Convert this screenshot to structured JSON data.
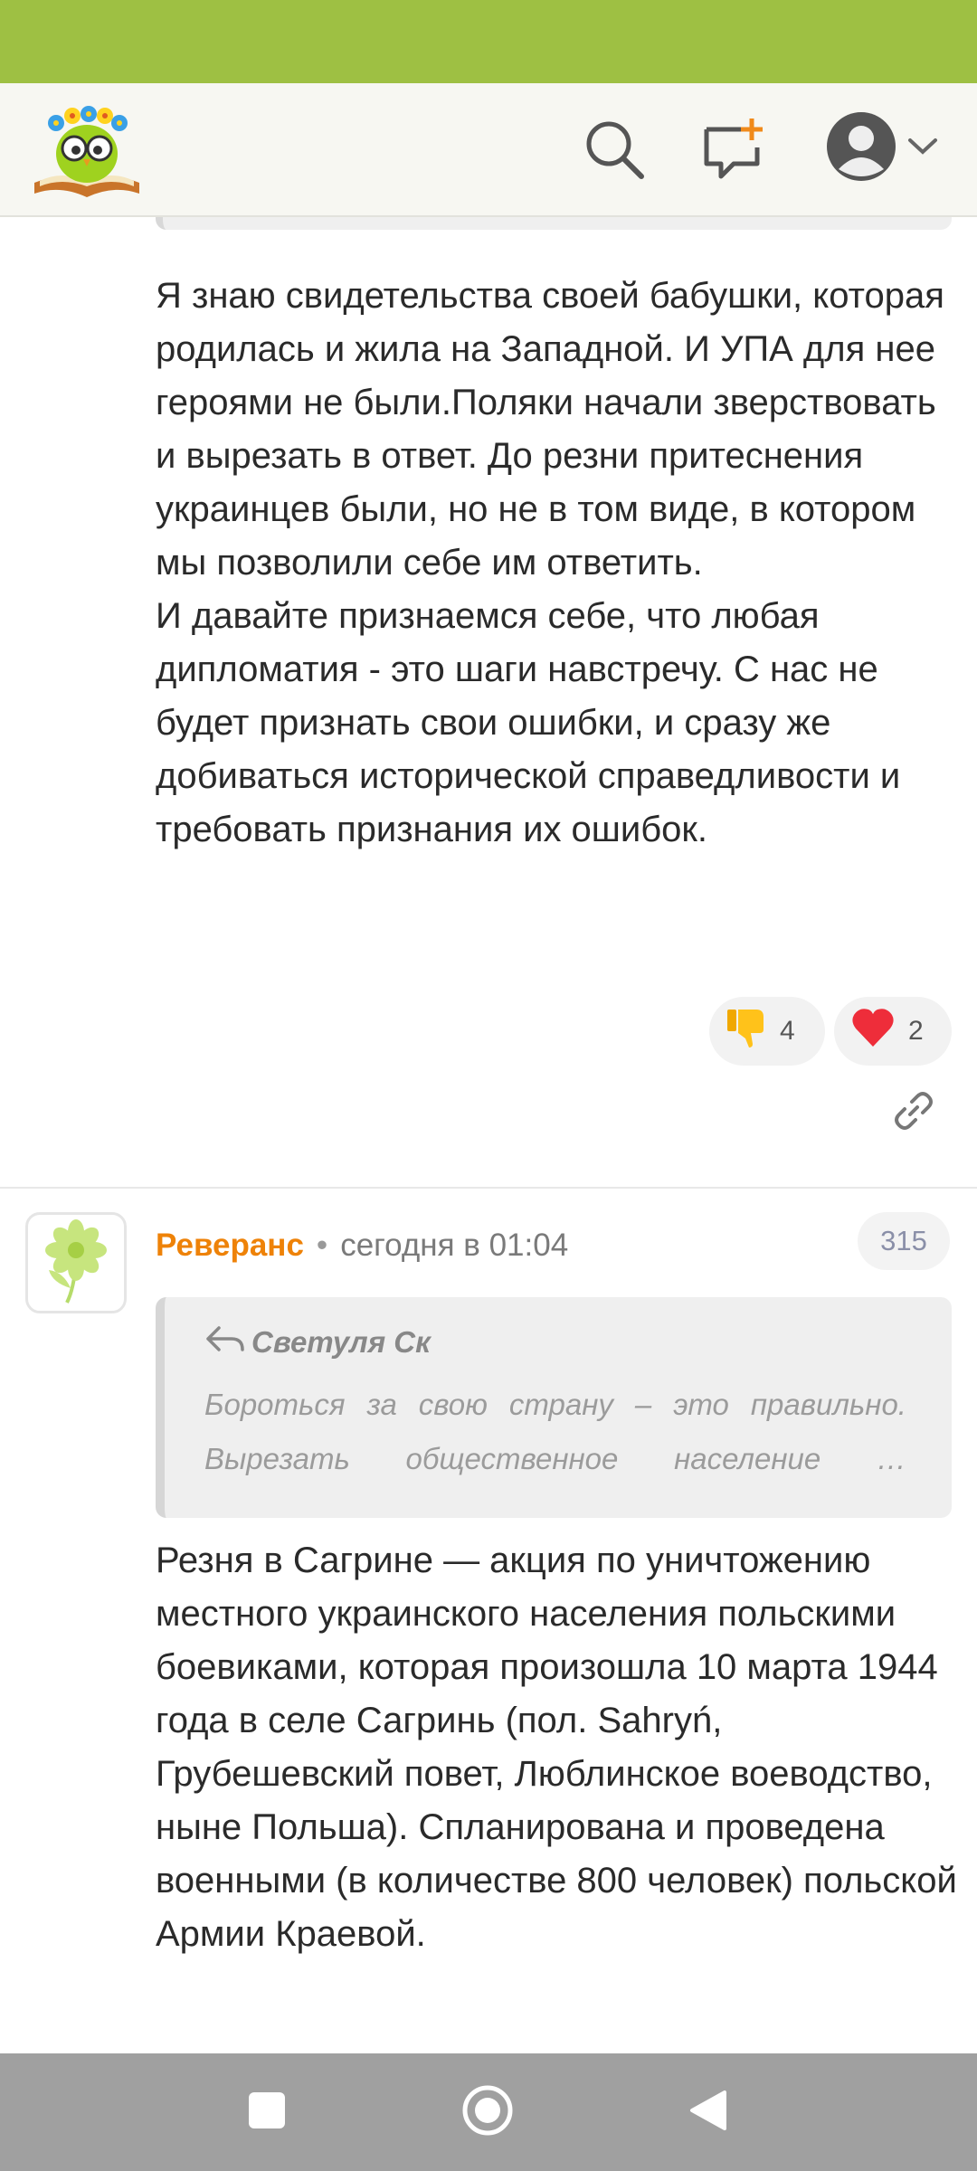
{
  "header": {
    "logo_icon": "owl-on-book-logo-icon",
    "search_icon": "search-icon",
    "new_post_icon": "new-message-plus-icon",
    "profile_icon": "user-avatar-icon",
    "dropdown_icon": "chevron-down-icon"
  },
  "comment_1": {
    "text": "Я знаю свидетельства своей бабушки, которая родилась и жила на Западной. И УПА для нее героями не были.Поляки начали зверствовать и вырезать в ответ. До резни притеснения украинцев были, но не в том виде, в котором мы позволили себе им ответить.\nИ давайте признаемся себе, что любая дипломатия - это шаги навстречу. С нас не будет признать свои ошибки, и сразу же добиваться исторической справедливости и требовать признания их ошибок.",
    "reactions": [
      {
        "icon": "thumbs-down-icon",
        "count": "4"
      },
      {
        "icon": "heart-icon",
        "count": "2"
      }
    ],
    "link_icon": "link-icon"
  },
  "comment_2": {
    "author": "Реверанс",
    "separator": "•",
    "time": "сегодня в 01:04",
    "number": "315",
    "avatar_icon": "green-flower-avatar-icon",
    "quote": {
      "reply_icon": "reply-arrow-icon",
      "author": "Светуля Ск",
      "line1_words": [
        "Бороться",
        "за",
        "свою",
        "страну",
        "–",
        "это",
        "правильно."
      ],
      "line2_words": [
        "Вырезать",
        "общественное",
        "население",
        "…"
      ]
    },
    "text": "Резня в Сагрине — акция по уничтожению местного украинского населения польскими боевиками, которая произошла 10 марта 1944 года в селе Сагринь (пол. Sahryń, Грубешевский повет, Люблинское воеводство, ныне Польша). Спланирована и проведена военными (в количестве 800 человек) польской Армии Краевой."
  },
  "navbar": {
    "recents_icon": "square-recents-icon",
    "home_icon": "circle-home-icon",
    "back_icon": "triangle-back-icon"
  },
  "colors": {
    "status_bar": "#9ec043",
    "author": "#ee8208",
    "nav_bar": "#a0a0a0"
  }
}
